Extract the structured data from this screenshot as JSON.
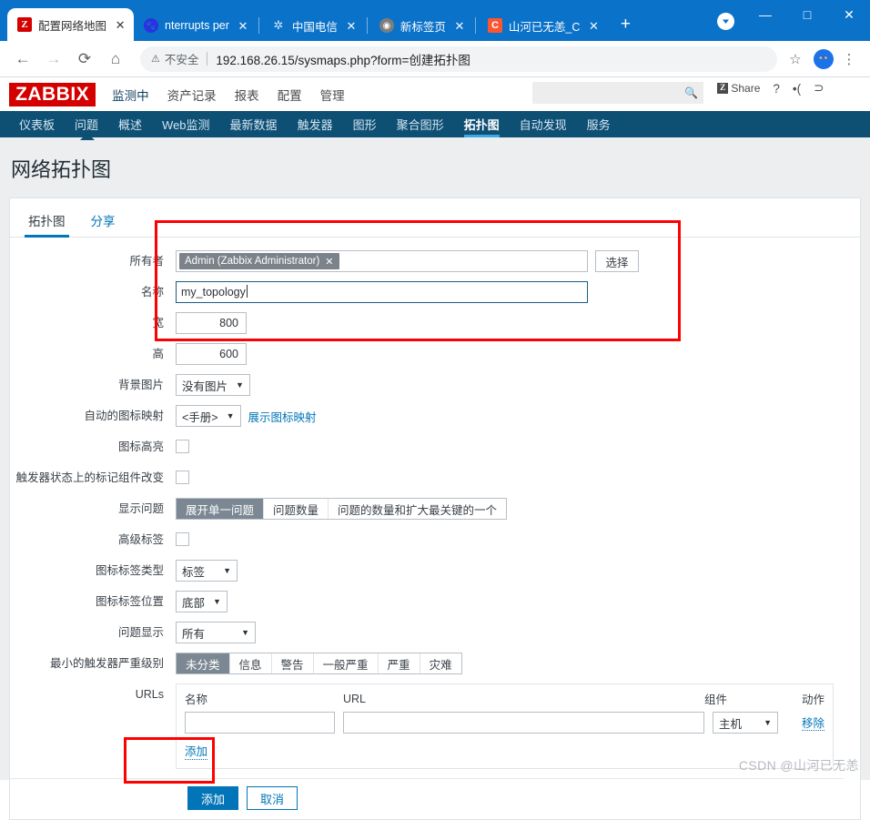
{
  "browser": {
    "tabs": [
      {
        "title": "配置网络地图",
        "favicon": "zabbix-icon",
        "active": true
      },
      {
        "title": "nterrupts per",
        "favicon": "baidu-icon",
        "active": false
      },
      {
        "title": "中国电信",
        "favicon": "telecom-icon",
        "active": false
      },
      {
        "title": "新标签页",
        "favicon": "globe-icon",
        "active": false
      },
      {
        "title": "山河已无恙_C",
        "favicon": "csdn-icon",
        "active": false
      }
    ],
    "new_tab_label": "+",
    "window_controls": {
      "minimize": "—",
      "maximize": "□",
      "close": "✕"
    },
    "toolbar": {
      "back": "←",
      "forward": "→",
      "reload": "⟳",
      "home": "⌂",
      "security_label": "不安全",
      "url": "192.168.26.15/sysmaps.php?form=创建拓扑图",
      "star": "☆",
      "menu": "⋮"
    }
  },
  "zabbix": {
    "logo": "ZABBIX",
    "main_menu": [
      {
        "label": "监测中",
        "active": true
      },
      {
        "label": "资产记录",
        "active": false
      },
      {
        "label": "报表",
        "active": false
      },
      {
        "label": "配置",
        "active": false
      },
      {
        "label": "管理",
        "active": false
      }
    ],
    "search_placeholder": "",
    "search_value": "",
    "share_label": "Share",
    "share_mark": "Z",
    "help_icon": "?",
    "support_icon": "•(",
    "signout_icon": "⊃",
    "sub_menu": [
      {
        "label": "仪表板",
        "active": false
      },
      {
        "label": "问题",
        "active": false
      },
      {
        "label": "概述",
        "active": false
      },
      {
        "label": "Web监测",
        "active": false
      },
      {
        "label": "最新数据",
        "active": false
      },
      {
        "label": "触发器",
        "active": false
      },
      {
        "label": "图形",
        "active": false
      },
      {
        "label": "聚合图形",
        "active": false
      },
      {
        "label": "拓扑图",
        "active": true
      },
      {
        "label": "自动发现",
        "active": false
      },
      {
        "label": "服务",
        "active": false
      }
    ]
  },
  "page": {
    "title": "网络拓扑图",
    "tabs": [
      {
        "label": "拓扑图",
        "active": true
      },
      {
        "label": "分享",
        "active": false
      }
    ]
  },
  "form": {
    "owner": {
      "label": "所有者",
      "chip": "Admin (Zabbix Administrator)",
      "chip_remove": "✕",
      "select_button": "选择"
    },
    "name": {
      "label": "名称",
      "value": "my_topology"
    },
    "width": {
      "label": "宽",
      "value": "800"
    },
    "height": {
      "label": "高",
      "value": "600"
    },
    "background_image": {
      "label": "背景图片",
      "value": "没有图片"
    },
    "icon_mapping": {
      "label": "自动的图标映射",
      "value": "<手册>",
      "link": "展示图标映射"
    },
    "icon_highlight": {
      "label": "图标高亮",
      "checked": false
    },
    "mark_changed": {
      "label": "触发器状态上的标记组件改变",
      "checked": false
    },
    "problem_display": {
      "label": "显示问题",
      "options": [
        "展开单一问题",
        "问题数量",
        "问题的数量和扩大最关键的一个"
      ],
      "selected_index": 0
    },
    "advanced_labels": {
      "label": "高级标签",
      "checked": false
    },
    "icon_label_type": {
      "label": "图标标签类型",
      "value": "标签"
    },
    "icon_label_location": {
      "label": "图标标签位置",
      "value": "底部"
    },
    "problem_show": {
      "label": "问题显示",
      "value": "所有"
    },
    "min_severity": {
      "label": "最小的触发器严重级别",
      "options": [
        "未分类",
        "信息",
        "警告",
        "一般严重",
        "严重",
        "灾难"
      ],
      "selected_index": 0
    },
    "urls": {
      "label": "URLs",
      "columns": [
        "名称",
        "URL",
        "组件",
        "动作"
      ],
      "rows": [
        {
          "name": "",
          "url": "",
          "element": "主机",
          "action": "移除"
        }
      ],
      "add_link": "添加"
    },
    "buttons": {
      "submit": "添加",
      "cancel": "取消"
    }
  },
  "watermark": "CSDN @山河已无恙",
  "colors": {
    "chrome_blue": "#0b72c9",
    "zabbix_red": "#d40000",
    "subnav_blue": "#0e4f74",
    "accent": "#0275b8",
    "highlight_red": "#ff0000"
  }
}
